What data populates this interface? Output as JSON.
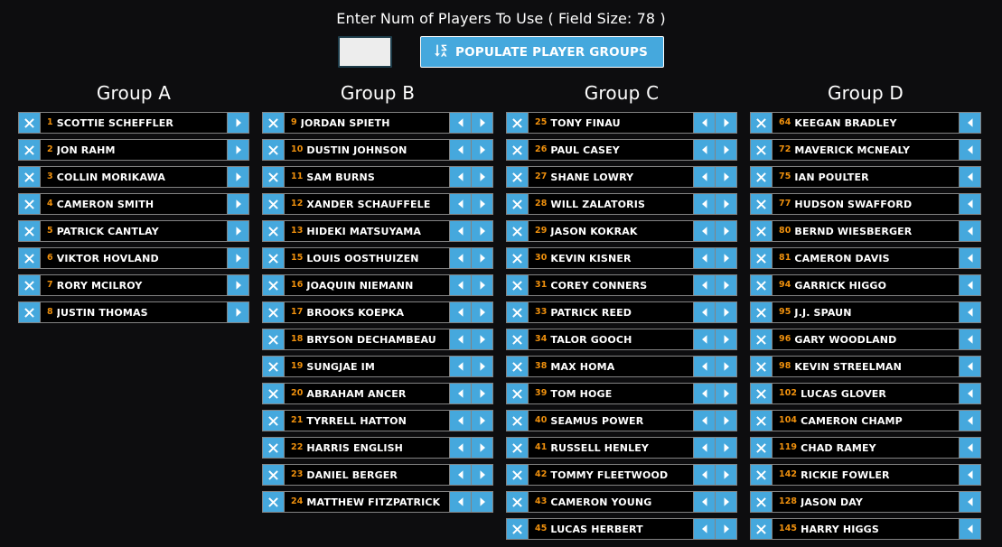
{
  "header": {
    "prompt": "Enter Num of Players To Use ( Field Size: 78 )",
    "field_size": 78,
    "input_value": "",
    "input_placeholder": "",
    "populate_label": "POPULATE PLAYER GROUPS",
    "populate_icon": "sort-amount-down-icon"
  },
  "colors": {
    "background": "#0d0d0f",
    "accent_blue": "#45a8dd",
    "rank_orange": "#ef900d",
    "row_border": "#838383",
    "row_fill": "#000000",
    "text_white": "#ffffff",
    "input_fill": "#ededed"
  },
  "groups": [
    {
      "title": "Group A",
      "has_left_arrow": false,
      "has_right_arrow": true,
      "players": [
        {
          "rank": "1",
          "name": "SCOTTIE SCHEFFLER"
        },
        {
          "rank": "2",
          "name": "JON RAHM"
        },
        {
          "rank": "3",
          "name": "COLLIN MORIKAWA"
        },
        {
          "rank": "4",
          "name": "CAMERON SMITH"
        },
        {
          "rank": "5",
          "name": "PATRICK CANTLAY"
        },
        {
          "rank": "6",
          "name": "VIKTOR HOVLAND"
        },
        {
          "rank": "7",
          "name": "RORY MCILROY"
        },
        {
          "rank": "8",
          "name": "JUSTIN THOMAS"
        }
      ]
    },
    {
      "title": "Group B",
      "has_left_arrow": true,
      "has_right_arrow": true,
      "players": [
        {
          "rank": "9",
          "name": "JORDAN SPIETH"
        },
        {
          "rank": "10",
          "name": "DUSTIN JOHNSON"
        },
        {
          "rank": "11",
          "name": "SAM BURNS"
        },
        {
          "rank": "12",
          "name": "XANDER SCHAUFFELE"
        },
        {
          "rank": "13",
          "name": "HIDEKI MATSUYAMA"
        },
        {
          "rank": "15",
          "name": "LOUIS OOSTHUIZEN"
        },
        {
          "rank": "16",
          "name": "JOAQUIN NIEMANN"
        },
        {
          "rank": "17",
          "name": "BROOKS KOEPKA"
        },
        {
          "rank": "18",
          "name": "BRYSON DECHAMBEAU"
        },
        {
          "rank": "19",
          "name": "SUNGJAE IM"
        },
        {
          "rank": "20",
          "name": "ABRAHAM ANCER"
        },
        {
          "rank": "21",
          "name": "TYRRELL HATTON"
        },
        {
          "rank": "22",
          "name": "HARRIS ENGLISH"
        },
        {
          "rank": "23",
          "name": "DANIEL BERGER"
        },
        {
          "rank": "24",
          "name": "MATTHEW FITZPATRICK"
        }
      ]
    },
    {
      "title": "Group C",
      "has_left_arrow": true,
      "has_right_arrow": true,
      "players": [
        {
          "rank": "25",
          "name": "TONY FINAU"
        },
        {
          "rank": "26",
          "name": "PAUL CASEY"
        },
        {
          "rank": "27",
          "name": "SHANE LOWRY"
        },
        {
          "rank": "28",
          "name": "WILL ZALATORIS"
        },
        {
          "rank": "29",
          "name": "JASON KOKRAK"
        },
        {
          "rank": "30",
          "name": "KEVIN KISNER"
        },
        {
          "rank": "31",
          "name": "COREY CONNERS"
        },
        {
          "rank": "33",
          "name": "PATRICK REED"
        },
        {
          "rank": "34",
          "name": "TALOR GOOCH"
        },
        {
          "rank": "38",
          "name": "MAX HOMA"
        },
        {
          "rank": "39",
          "name": "TOM HOGE"
        },
        {
          "rank": "40",
          "name": "SEAMUS POWER"
        },
        {
          "rank": "41",
          "name": "RUSSELL HENLEY"
        },
        {
          "rank": "42",
          "name": "TOMMY FLEETWOOD"
        },
        {
          "rank": "43",
          "name": "CAMERON YOUNG"
        },
        {
          "rank": "45",
          "name": "LUCAS HERBERT"
        }
      ]
    },
    {
      "title": "Group D",
      "has_left_arrow": true,
      "has_right_arrow": false,
      "players": [
        {
          "rank": "64",
          "name": "KEEGAN BRADLEY"
        },
        {
          "rank": "72",
          "name": "MAVERICK MCNEALY"
        },
        {
          "rank": "75",
          "name": "IAN POULTER"
        },
        {
          "rank": "77",
          "name": "HUDSON SWAFFORD"
        },
        {
          "rank": "80",
          "name": "BERND WIESBERGER"
        },
        {
          "rank": "81",
          "name": "CAMERON DAVIS"
        },
        {
          "rank": "94",
          "name": "GARRICK HIGGO"
        },
        {
          "rank": "95",
          "name": "J.J. SPAUN"
        },
        {
          "rank": "96",
          "name": "GARY WOODLAND"
        },
        {
          "rank": "98",
          "name": "KEVIN STREELMAN"
        },
        {
          "rank": "102",
          "name": "LUCAS GLOVER"
        },
        {
          "rank": "104",
          "name": "CAMERON CHAMP"
        },
        {
          "rank": "119",
          "name": "CHAD RAMEY"
        },
        {
          "rank": "142",
          "name": "RICKIE FOWLER"
        },
        {
          "rank": "128",
          "name": "JASON DAY"
        },
        {
          "rank": "145",
          "name": "HARRY HIGGS"
        }
      ]
    }
  ]
}
